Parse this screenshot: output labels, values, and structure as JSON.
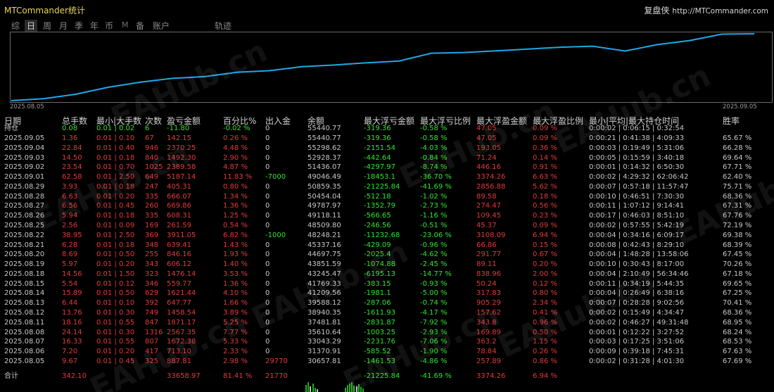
{
  "app": {
    "title": "MTCommander统计",
    "brand_cn": "复盘侠",
    "brand_url": "http://MTCommander.com"
  },
  "tabs": [
    {
      "label": "综",
      "active": false
    },
    {
      "label": "日",
      "active": true
    },
    {
      "label": "周",
      "active": false
    },
    {
      "label": "月",
      "active": false
    },
    {
      "label": "季",
      "active": false
    },
    {
      "label": "年",
      "active": false
    },
    {
      "label": "币",
      "active": false
    },
    {
      "label": "M",
      "active": false
    },
    {
      "label": "备",
      "active": false
    },
    {
      "label": "账户",
      "active": false
    },
    {
      "label": "轨迹",
      "active": false
    }
  ],
  "chart": {
    "start_date": "2025.08.05",
    "end_date": "2025.09.05",
    "line_color": "#1fa8e6",
    "balance_series": [
      30657.81,
      31370.91,
      33043.29,
      35610.64,
      37481.81,
      38940.35,
      39588.12,
      41209.56,
      41769.33,
      43245.47,
      43851.59,
      44697.75,
      45337.16,
      48248.21,
      48509.8,
      49118.11,
      49787.97,
      50454.04,
      50859.35,
      49046.49,
      51436.07,
      52928.37,
      55298.62,
      55440.77
    ]
  },
  "columns": [
    "日期",
    "总手数",
    "最小|大手数",
    "次数",
    "盈亏金额",
    "百分比%",
    "出入金",
    "余额",
    "最大浮亏金额",
    "最大浮亏比例",
    "最大浮盈金额",
    "最大浮盈比例",
    "最小|平均|最大持仓时间",
    "胜率"
  ],
  "open_row": {
    "label": "持仓",
    "lots": "0.08",
    "minmax": "0.01 | 0.02",
    "count": "6",
    "pnl": "-11.80",
    "pct": "-0.02 %",
    "io": "0",
    "balance": "55440.77",
    "maxdd": "-319.36",
    "maxddpct": "-0.58 %",
    "maxfp": "47.05",
    "maxfppct": "0.09 %",
    "hold": "0:00:02 | 0:06:15 | 0:32:54",
    "win": ""
  },
  "rows": [
    {
      "date": "2025.09.05",
      "lots": "1.36",
      "minmax": "0.01 | 0.10",
      "count": "67",
      "pnl": "142.15",
      "pct": "0.26 %",
      "io": "0",
      "balance": "55440.77",
      "maxdd": "-319.36",
      "maxddpct": "-0.58 %",
      "maxfp": "47.05",
      "maxfppct": "0.09 %",
      "hold": "0:00:21 | 0:41:38 | 4:09:33",
      "win": "65.67 %"
    },
    {
      "date": "2025.09.04",
      "lots": "22.84",
      "minmax": "0.01 | 0.40",
      "count": "946",
      "pnl": "2370.25",
      "pct": "4.48 %",
      "io": "0",
      "balance": "55298.62",
      "maxdd": "-2151.54",
      "maxddpct": "-4.03 %",
      "maxfp": "193.05",
      "maxfppct": "0.36 %",
      "hold": "0:00:03 | 0:19:49 | 5:31:06",
      "win": "66.28 %"
    },
    {
      "date": "2025.09.03",
      "lots": "14.50",
      "minmax": "0.01 | 0.18",
      "count": "840",
      "pnl": "1492.30",
      "pct": "2.90 %",
      "io": "0",
      "balance": "52928.37",
      "maxdd": "-442.64",
      "maxddpct": "-0.84 %",
      "maxfp": "71.24",
      "maxfppct": "0.14 %",
      "hold": "0:00:05 | 0:15:59 | 3:40:18",
      "win": "69.64 %"
    },
    {
      "date": "2025.09.02",
      "lots": "23.54",
      "minmax": "0.01 | 0.70",
      "count": "1025",
      "pnl": "2389.58",
      "pct": "4.87 %",
      "io": "0",
      "balance": "51436.07",
      "maxdd": "-4297.97",
      "maxddpct": "-8.74 %",
      "maxfp": "446.16",
      "maxfppct": "0.91 %",
      "hold": "0:00:01 | 0:14:32 | 6:50:30",
      "win": "67.71 %"
    },
    {
      "date": "2025.09.01",
      "lots": "62.58",
      "minmax": "0.01 | 2.50",
      "count": "649",
      "pnl": "5187.14",
      "pct": "11.83 %",
      "io": "-7000",
      "balance": "49046.49",
      "maxdd": "-18453.1",
      "maxddpct": "-36.70 %",
      "maxfp": "3374.26",
      "maxfppct": "6.63 %",
      "hold": "0:00:02 | 4:29:32 | 62:06:42",
      "win": "62.40 %"
    },
    {
      "date": "2025.08.29",
      "lots": "3.93",
      "minmax": "0.01 | 0.18",
      "count": "247",
      "pnl": "405.31",
      "pct": "0.80 %",
      "io": "0",
      "balance": "50859.35",
      "maxdd": "-21225.84",
      "maxddpct": "-41.69 %",
      "maxfp": "2856.88",
      "maxfppct": "5.62 %",
      "hold": "0:00:07 | 0:57:18 | 11:57:47",
      "win": "75.71 %"
    },
    {
      "date": "2025.08.28",
      "lots": "6.63",
      "minmax": "0.01 | 0.20",
      "count": "335",
      "pnl": "666.07",
      "pct": "1.34 %",
      "io": "0",
      "balance": "50454.04",
      "maxdd": "-512.18",
      "maxddpct": "-1.02 %",
      "maxfp": "89.58",
      "maxfppct": "0.18 %",
      "hold": "0:00:10 | 0:46:51 | 7:30:30",
      "win": "68.36 %"
    },
    {
      "date": "2025.08.27",
      "lots": "6.56",
      "minmax": "0.01 | 0.45",
      "count": "260",
      "pnl": "669.86",
      "pct": "1.36 %",
      "io": "0",
      "balance": "49787.97",
      "maxdd": "-1352.79",
      "maxddpct": "-2.73 %",
      "maxfp": "274.47",
      "maxfppct": "0.56 %",
      "hold": "0:00:11 | 1:07:12 | 9:14:41",
      "win": "67.31 %"
    },
    {
      "date": "2025.08.26",
      "lots": "5.94",
      "minmax": "0.01 | 0.18",
      "count": "335",
      "pnl": "608.31",
      "pct": "1.25 %",
      "io": "0",
      "balance": "49118.11",
      "maxdd": "-566.65",
      "maxddpct": "-1.16 %",
      "maxfp": "109.45",
      "maxfppct": "0.23 %",
      "hold": "0:00:17 | 0:46:03 | 8:51:10",
      "win": "67.76 %"
    },
    {
      "date": "2025.08.25",
      "lots": "2.56",
      "minmax": "0.01 | 0.09",
      "count": "169",
      "pnl": "261.59",
      "pct": "0.54 %",
      "io": "0",
      "balance": "48509.80",
      "maxdd": "-246.56",
      "maxddpct": "-0.51 %",
      "maxfp": "45.37",
      "maxfppct": "0.09 %",
      "hold": "0:00:02 | 0:57:55 | 5:42:19",
      "win": "72.19 %"
    },
    {
      "date": "2025.08.22",
      "lots": "38.95",
      "minmax": "0.01 | 2.50",
      "count": "369",
      "pnl": "3911.05",
      "pct": "6.82 %",
      "io": "-1000",
      "balance": "48248.21",
      "maxdd": "-11232.68",
      "maxddpct": "-23.06 %",
      "maxfp": "3108.09",
      "maxfppct": "6.94 %",
      "hold": "0:00:04 | 0:34:16 | 6:09:17",
      "win": "69.38 %"
    },
    {
      "date": "2025.08.21",
      "lots": "6.28",
      "minmax": "0.01 | 0.18",
      "count": "348",
      "pnl": "639.41",
      "pct": "1.43 %",
      "io": "0",
      "balance": "45337.16",
      "maxdd": "-429.09",
      "maxddpct": "-0.96 %",
      "maxfp": "66.86",
      "maxfppct": "0.15 %",
      "hold": "0:00:08 | 0:42:43 | 8:29:10",
      "win": "68.39 %"
    },
    {
      "date": "2025.08.20",
      "lots": "8.69",
      "minmax": "0.01 | 0.50",
      "count": "255",
      "pnl": "846.16",
      "pct": "1.93 %",
      "io": "0",
      "balance": "44697.75",
      "maxdd": "-2025.4",
      "maxddpct": "-4.62 %",
      "maxfp": "291.77",
      "maxfppct": "0.67 %",
      "hold": "0:00:04 | 1:48:28 | 13:58:06",
      "win": "67.45 %"
    },
    {
      "date": "2025.08.19",
      "lots": "5.97",
      "minmax": "0.01 | 0.20",
      "count": "343",
      "pnl": "606.12",
      "pct": "1.40 %",
      "io": "0",
      "balance": "43851.59",
      "maxdd": "-1074.88",
      "maxddpct": "-2.45 %",
      "maxfp": "89.11",
      "maxfppct": "0.20 %",
      "hold": "0:00:10 | 0:30:43 | 8:17:00",
      "win": "70.26 %"
    },
    {
      "date": "2025.08.18",
      "lots": "14.56",
      "minmax": "0.01 | 1.50",
      "count": "323",
      "pnl": "1476.14",
      "pct": "3.53 %",
      "io": "0",
      "balance": "43245.47",
      "maxdd": "-6195.13",
      "maxddpct": "-14.77 %",
      "maxfp": "838.96",
      "maxfppct": "2.00 %",
      "hold": "0:00:04 | 2:10:49 | 56:34:46",
      "win": "67.18 %"
    },
    {
      "date": "2025.08.15",
      "lots": "5.54",
      "minmax": "0.01 | 0.12",
      "count": "346",
      "pnl": "559.77",
      "pct": "1.36 %",
      "io": "0",
      "balance": "41769.33",
      "maxdd": "-383.15",
      "maxddpct": "-0.93 %",
      "maxfp": "50.24",
      "maxfppct": "0.12 %",
      "hold": "0:00:11 | 0:34:19 | 5:44:35",
      "win": "69.65 %"
    },
    {
      "date": "2025.08.14",
      "lots": "15.89",
      "minmax": "0.01 | 0.50",
      "count": "629",
      "pnl": "1621.44",
      "pct": "4.10 %",
      "io": "0",
      "balance": "41209.56",
      "maxdd": "-1981.1",
      "maxddpct": "-5.00 %",
      "maxfp": "317.83",
      "maxfppct": "0.80 %",
      "hold": "0:00:04 | 0:26:49 | 6:38:16",
      "win": "67.25 %"
    },
    {
      "date": "2025.08.13",
      "lots": "6.44",
      "minmax": "0.01 | 0.10",
      "count": "392",
      "pnl": "647.77",
      "pct": "1.66 %",
      "io": "0",
      "balance": "39588.12",
      "maxdd": "-287.06",
      "maxddpct": "-0.74 %",
      "maxfp": "905.29",
      "maxfppct": "2.34 %",
      "hold": "0:00:07 | 0:28:28 | 9:02:56",
      "win": "70.41 %"
    },
    {
      "date": "2025.08.12",
      "lots": "13.76",
      "minmax": "0.01 | 0.30",
      "count": "749",
      "pnl": "1458.54",
      "pct": "3.89 %",
      "io": "0",
      "balance": "38940.35",
      "maxdd": "-1611.93",
      "maxddpct": "-4.17 %",
      "maxfp": "157.62",
      "maxfppct": "0.41 %",
      "hold": "0:00:02 | 0:15:49 | 4:34:47",
      "win": "68.36 %"
    },
    {
      "date": "2025.08.11",
      "lots": "18.16",
      "minmax": "0.01 | 0.55",
      "count": "847",
      "pnl": "1871.17",
      "pct": "5.25 %",
      "io": "0",
      "balance": "37481.81",
      "maxdd": "-2831.87",
      "maxddpct": "-7.92 %",
      "maxfp": "343.8",
      "maxfppct": "0.96 %",
      "hold": "0:00:02 | 0:46:27 | 49:31:48",
      "win": "68.95 %"
    },
    {
      "date": "2025.08.08",
      "lots": "24.14",
      "minmax": "0.01 | 0.30",
      "count": "1316",
      "pnl": "2567.35",
      "pct": "7.77 %",
      "io": "0",
      "balance": "35610.64",
      "maxdd": "-1003.25",
      "maxddpct": "-2.93 %",
      "maxfp": "169.89",
      "maxfppct": "0.50 %",
      "hold": "0:00:01 | 0:12:22 | 3:27:52",
      "win": "68.24 %"
    },
    {
      "date": "2025.08.07",
      "lots": "16.33",
      "minmax": "0.01 | 0.55",
      "count": "807",
      "pnl": "1672.38",
      "pct": "5.33 %",
      "io": "0",
      "balance": "33043.29",
      "maxdd": "-2231.76",
      "maxddpct": "-7.06 %",
      "maxfp": "363.2",
      "maxfppct": "1.15 %",
      "hold": "0:00:03 | 0:17:25 | 3:51:06",
      "win": "68.53 %"
    },
    {
      "date": "2025.08.06",
      "lots": "7.20",
      "minmax": "0.01 | 0.20",
      "count": "417",
      "pnl": "713.10",
      "pct": "2.33 %",
      "io": "0",
      "balance": "31370.91",
      "maxdd": "-585.52",
      "maxddpct": "-1.90 %",
      "maxfp": "78.84",
      "maxfppct": "0.26 %",
      "hold": "0:00:09 | 0:39:18 | 7:45:31",
      "win": "67.63 %"
    },
    {
      "date": "2025.08.05",
      "lots": "9.67",
      "minmax": "0.01 | 0.45",
      "count": "325",
      "pnl": "887.81",
      "pct": "2.98 %",
      "io": "29770",
      "balance": "30657.81",
      "maxdd": "-1461.53",
      "maxddpct": "-4.86 %",
      "maxfp": "257.89",
      "maxfppct": "0.86 %",
      "hold": "0:00:02 | 0:31:28 | 4:01:30",
      "win": "67.69 %"
    }
  ],
  "total_row": {
    "label": "合计",
    "lots": "342.10",
    "minmax": "",
    "count": "",
    "pnl": "33658.97",
    "pct": "81.41 %",
    "io": "21770",
    "balance": "",
    "maxdd": "-21225.84",
    "maxddpct": "-41.69 %",
    "maxfp": "3374.26",
    "maxfppct": "6.94 %",
    "hold": "",
    "win": ""
  },
  "watermark": "EAHub.cn"
}
